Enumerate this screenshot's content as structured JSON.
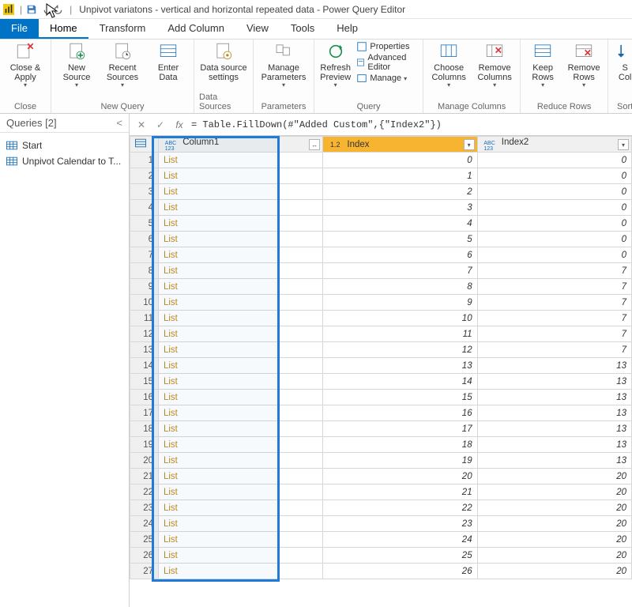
{
  "titlebar": {
    "title": "Unpivot variatons  - vertical and horizontal repeated data - Power Query Editor"
  },
  "menu": {
    "file": "File",
    "home": "Home",
    "transform": "Transform",
    "addcolumn": "Add Column",
    "view": "View",
    "tools": "Tools",
    "help": "Help"
  },
  "ribbon": {
    "close_apply": "Close &\nApply",
    "close_group": "Close",
    "new_source": "New\nSource",
    "recent_sources": "Recent\nSources",
    "enter_data": "Enter\nData",
    "new_query_group": "New Query",
    "datasource": "Data source\nsettings",
    "datasources_group": "Data Sources",
    "manage_params": "Manage\nParameters",
    "parameters_group": "Parameters",
    "refresh": "Refresh\nPreview",
    "properties": "Properties",
    "advanced": "Advanced Editor",
    "manage": "Manage",
    "query_group": "Query",
    "choose_cols": "Choose\nColumns",
    "remove_cols": "Remove\nColumns",
    "manage_cols_group": "Manage Columns",
    "keep_rows": "Keep\nRows",
    "remove_rows": "Remove\nRows",
    "reduce_rows_group": "Reduce Rows",
    "sort_col": "S\nCol",
    "sort_group": "Sort"
  },
  "queries": {
    "header": "Queries [2]",
    "items": [
      {
        "label": "Start"
      },
      {
        "label": "Unpivot Calendar to T..."
      }
    ]
  },
  "formula": {
    "text": "= Table.FillDown(#\"Added Custom\",{\"Index2\"})"
  },
  "grid": {
    "headers": {
      "column1": "Column1",
      "index": "Index",
      "index2": "Index2",
      "type_abc123": "ABC\n123",
      "type_12": "1.2"
    },
    "link_label": "List",
    "rows": [
      {
        "n": 1,
        "idx": 0,
        "idx2": 0
      },
      {
        "n": 2,
        "idx": 1,
        "idx2": 0
      },
      {
        "n": 3,
        "idx": 2,
        "idx2": 0
      },
      {
        "n": 4,
        "idx": 3,
        "idx2": 0
      },
      {
        "n": 5,
        "idx": 4,
        "idx2": 0
      },
      {
        "n": 6,
        "idx": 5,
        "idx2": 0
      },
      {
        "n": 7,
        "idx": 6,
        "idx2": 0
      },
      {
        "n": 8,
        "idx": 7,
        "idx2": 7
      },
      {
        "n": 9,
        "idx": 8,
        "idx2": 7
      },
      {
        "n": 10,
        "idx": 9,
        "idx2": 7
      },
      {
        "n": 11,
        "idx": 10,
        "idx2": 7
      },
      {
        "n": 12,
        "idx": 11,
        "idx2": 7
      },
      {
        "n": 13,
        "idx": 12,
        "idx2": 7
      },
      {
        "n": 14,
        "idx": 13,
        "idx2": 13
      },
      {
        "n": 15,
        "idx": 14,
        "idx2": 13
      },
      {
        "n": 16,
        "idx": 15,
        "idx2": 13
      },
      {
        "n": 17,
        "idx": 16,
        "idx2": 13
      },
      {
        "n": 18,
        "idx": 17,
        "idx2": 13
      },
      {
        "n": 19,
        "idx": 18,
        "idx2": 13
      },
      {
        "n": 20,
        "idx": 19,
        "idx2": 13
      },
      {
        "n": 21,
        "idx": 20,
        "idx2": 20
      },
      {
        "n": 22,
        "idx": 21,
        "idx2": 20
      },
      {
        "n": 23,
        "idx": 22,
        "idx2": 20
      },
      {
        "n": 24,
        "idx": 23,
        "idx2": 20
      },
      {
        "n": 25,
        "idx": 24,
        "idx2": 20
      },
      {
        "n": 26,
        "idx": 25,
        "idx2": 20
      },
      {
        "n": 27,
        "idx": 26,
        "idx2": 20
      }
    ]
  }
}
